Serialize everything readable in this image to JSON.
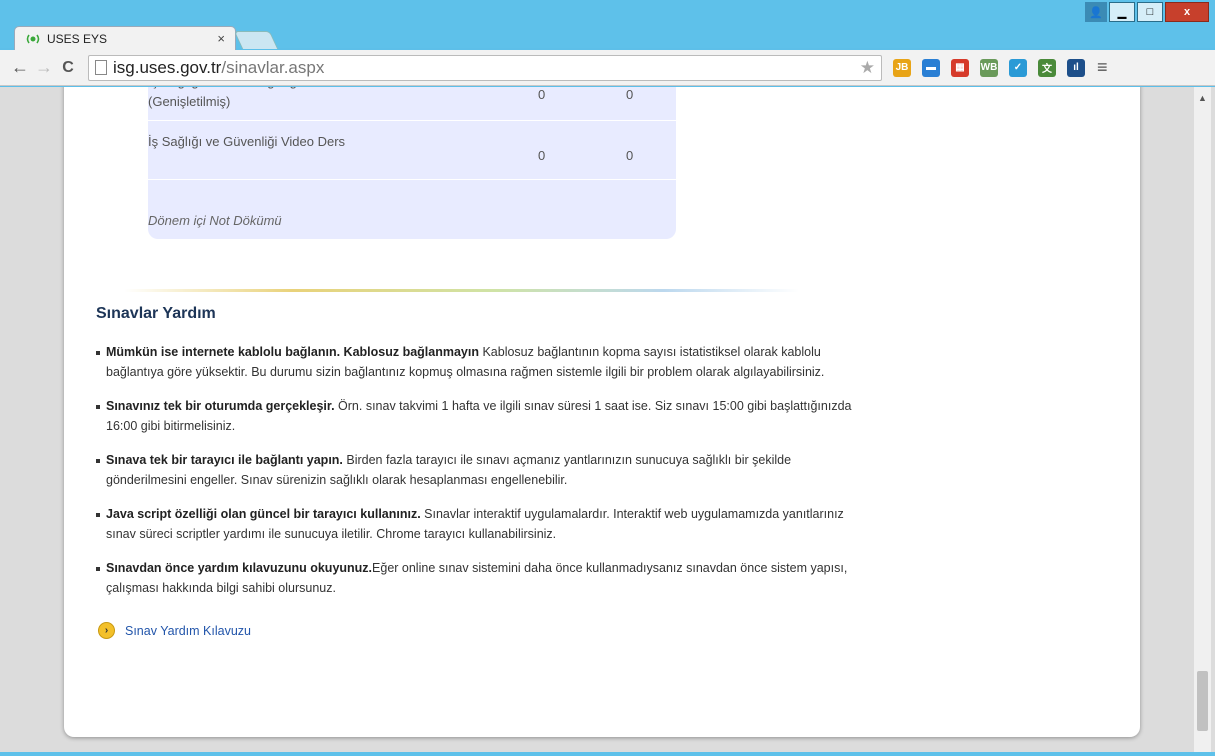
{
  "window": {
    "controls": {
      "user": "👤",
      "minimize": "▁",
      "maximize": "□",
      "close": "x"
    }
  },
  "tab": {
    "title": "USES EYS",
    "close": "×"
  },
  "toolbar": {
    "back": "←",
    "forward": "→",
    "reload": "C",
    "url_host": "isg.uses.gov.tr",
    "url_path": "/sinavlar.aspx",
    "star": "★",
    "extensions": [
      {
        "name": "jb-extension-icon",
        "text": "JB",
        "color": "#e8a417"
      },
      {
        "name": "window-extension-icon",
        "text": "▬",
        "color": "#2a7fd4"
      },
      {
        "name": "red-grid-extension-icon",
        "text": "▦",
        "color": "#d63a2a"
      },
      {
        "name": "wb-extension-icon",
        "text": "WB",
        "color": "#6a9a5a"
      },
      {
        "name": "check-extension-icon",
        "text": "✓",
        "color": "#2a9ad6"
      },
      {
        "name": "translate-extension-icon",
        "text": "文",
        "color": "#4a8a3a"
      },
      {
        "name": "chart-extension-icon",
        "text": "ıl",
        "color": "#1d4f8a"
      }
    ],
    "menu": "≡"
  },
  "scores": {
    "rows": [
      {
        "name": "İş Sağlığı ve Güvenliği Eğitimi (Genişletilmiş)",
        "v1": "0",
        "v2": "0"
      },
      {
        "name": "İş Sağlığı ve Güvenliği Video Ders",
        "v1": "0",
        "v2": "0"
      }
    ],
    "footer": "Dönem içi Not Dökümü"
  },
  "help": {
    "title": "Sınavlar Yardım",
    "items": [
      {
        "bold": "Mümkün ise internete kablolu bağlanın. Kablosuz bağlanmayın",
        "text": " Kablosuz bağlantının kopma sayısı istatistiksel olarak kablolu bağlantıya göre yüksektir. Bu durumu sizin bağlantınız kopmuş olmasına rağmen sistemle ilgili bir problem olarak algılayabilirsiniz."
      },
      {
        "bold": "Sınavınız tek bir oturumda gerçekleşir.",
        "text": " Örn. sınav takvimi 1 hafta ve ilgili sınav süresi 1 saat ise. Siz sınavı 15:00 gibi başlattığınızda 16:00 gibi bitirmelisiniz."
      },
      {
        "bold": "Sınava tek bir tarayıcı ile bağlantı yapın.",
        "text": " Birden fazla tarayıcı ile sınavı açmanız yantlarınızın sunucuya sağlıklı bir şekilde gönderilmesini engeller. Sınav sürenizin sağlıklı olarak hesaplanması engellenebilir."
      },
      {
        "bold": "Java script özelliği olan güncel bir tarayıcı kullanınız.",
        "text": " Sınavlar interaktif uygulamalardır. Interaktif web uygulamamızda yanıtlarınız sınav süreci scriptler yardımı ile sunucuya iletilir. Chrome tarayıcı kullanabilirsiniz."
      },
      {
        "bold": "Sınavdan önce yardım kılavuzunu okuyunuz.",
        "text": "Eğer online sınav sistemini daha önce kullanmadıysanız sınavdan önce sistem yapısı, çalışması hakkında bilgi sahibi olursunuz."
      }
    ],
    "link_icon": "›",
    "link_label": "Sınav Yardım Kılavuzu"
  },
  "scrollbar": {
    "up": "▲"
  }
}
